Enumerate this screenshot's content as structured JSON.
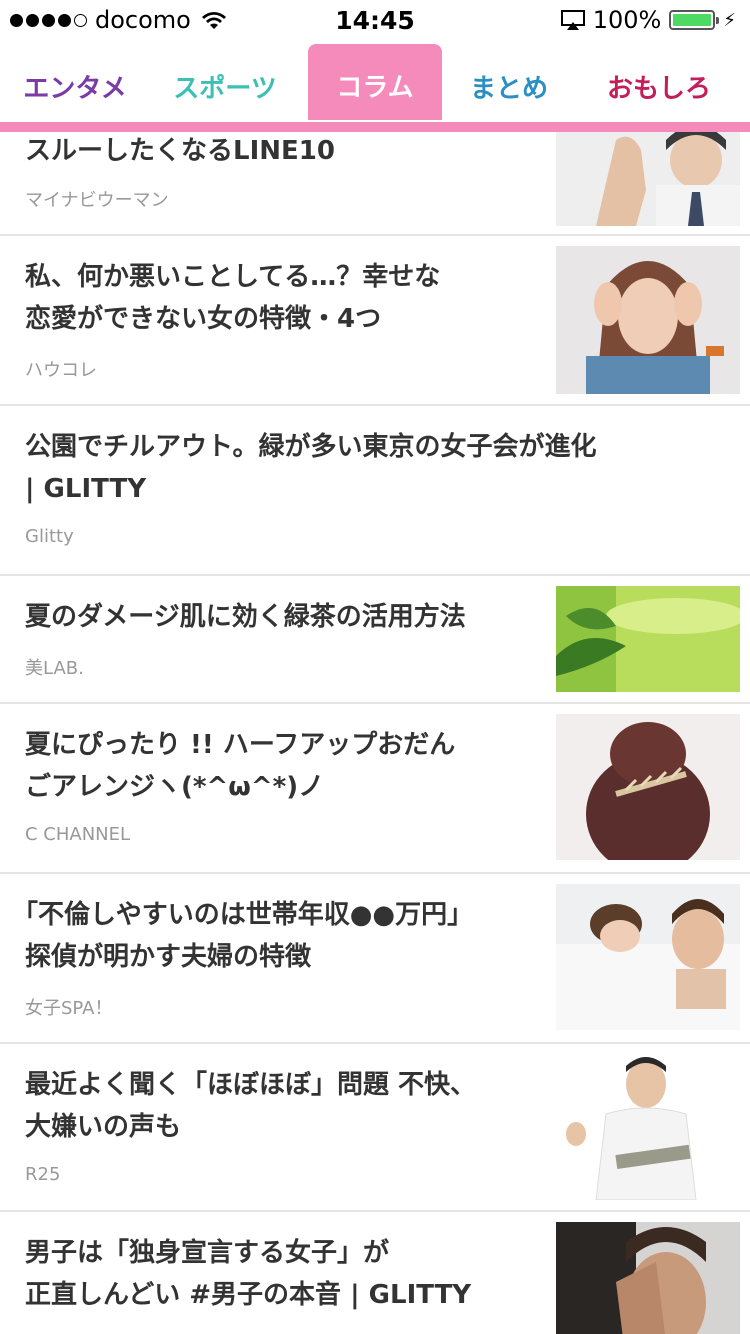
{
  "status_bar": {
    "carrier": "docomo",
    "time": "14:45",
    "battery_percent": "100%",
    "battery_level": 1.0
  },
  "tabs": [
    {
      "label": "エンタメ",
      "color": "#7b3aa6",
      "active": false
    },
    {
      "label": "スポーツ",
      "color": "#3cc0b4",
      "active": false
    },
    {
      "label": "コラム",
      "color": "#ffffff",
      "active": true
    },
    {
      "label": "まとめ",
      "color": "#2c8fc4",
      "active": false
    },
    {
      "label": "おもしろ",
      "color": "#c41d5a",
      "active": false
    }
  ],
  "accent_color": "#f48bbb",
  "feed": [
    {
      "title": "スルーしたくなるLINE10",
      "source": "マイナビウーマン",
      "thumb": "man-with-hand-image"
    },
    {
      "title": "私、何か悪いことしてる…？幸せな\n恋愛ができない女の特徴・4つ",
      "source": "ハウコレ",
      "thumb": "troubled-woman-image"
    },
    {
      "title": "公園でチルアウト。緑が多い東京の女子会が進化\n| GLITTY",
      "source": "Glitty",
      "thumb": ""
    },
    {
      "title": "夏のダメージ肌に効く緑茶の活用方法",
      "source": "美LAB.",
      "thumb": "green-tea-image"
    },
    {
      "title": "夏にぴったり !! ハーフアップおだん\nごアレンジヽ(*^ω^*)ノ",
      "source": "C CHANNEL",
      "thumb": "hair-bun-image"
    },
    {
      "title": "｢不倫しやすいのは世帯年収●●万円｣\n探偵が明かす夫婦の特徴",
      "source": "女子SPA！",
      "thumb": "couple-bed-image"
    },
    {
      "title": "最近よく聞く「ほぼほぼ」問題 不快、\n大嫌いの声も",
      "source": "R25",
      "thumb": "man-with-tablet-image"
    },
    {
      "title": "男子は「独身宣言する女子」が\n正直しんどい #男子の本音 | GLITTY",
      "source": "",
      "thumb": "stressed-man-image"
    }
  ]
}
